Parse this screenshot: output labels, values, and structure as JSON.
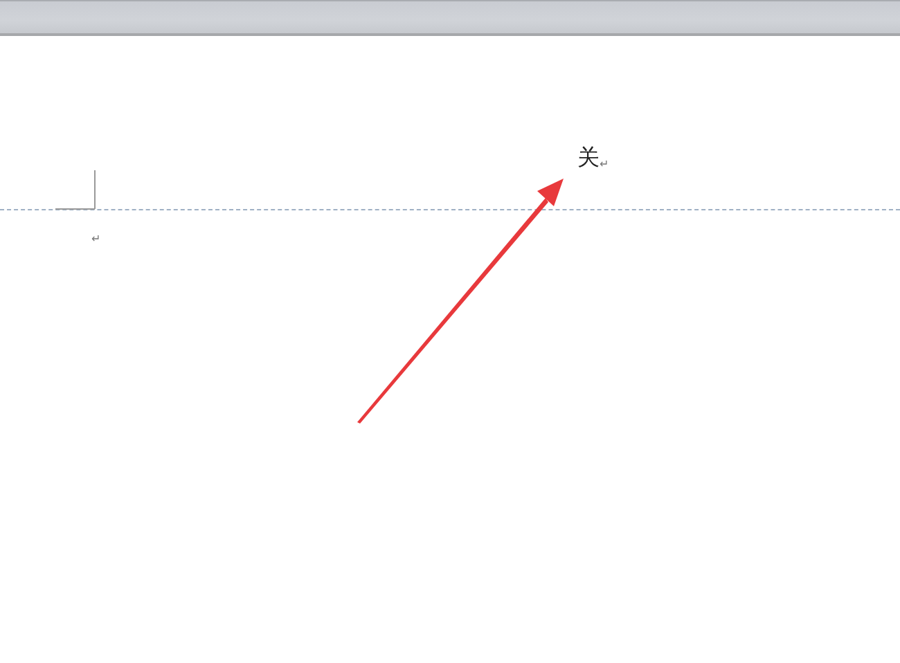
{
  "header": {
    "text": "关",
    "paragraph_mark": "↵"
  },
  "body": {
    "paragraph_mark": "↵"
  }
}
